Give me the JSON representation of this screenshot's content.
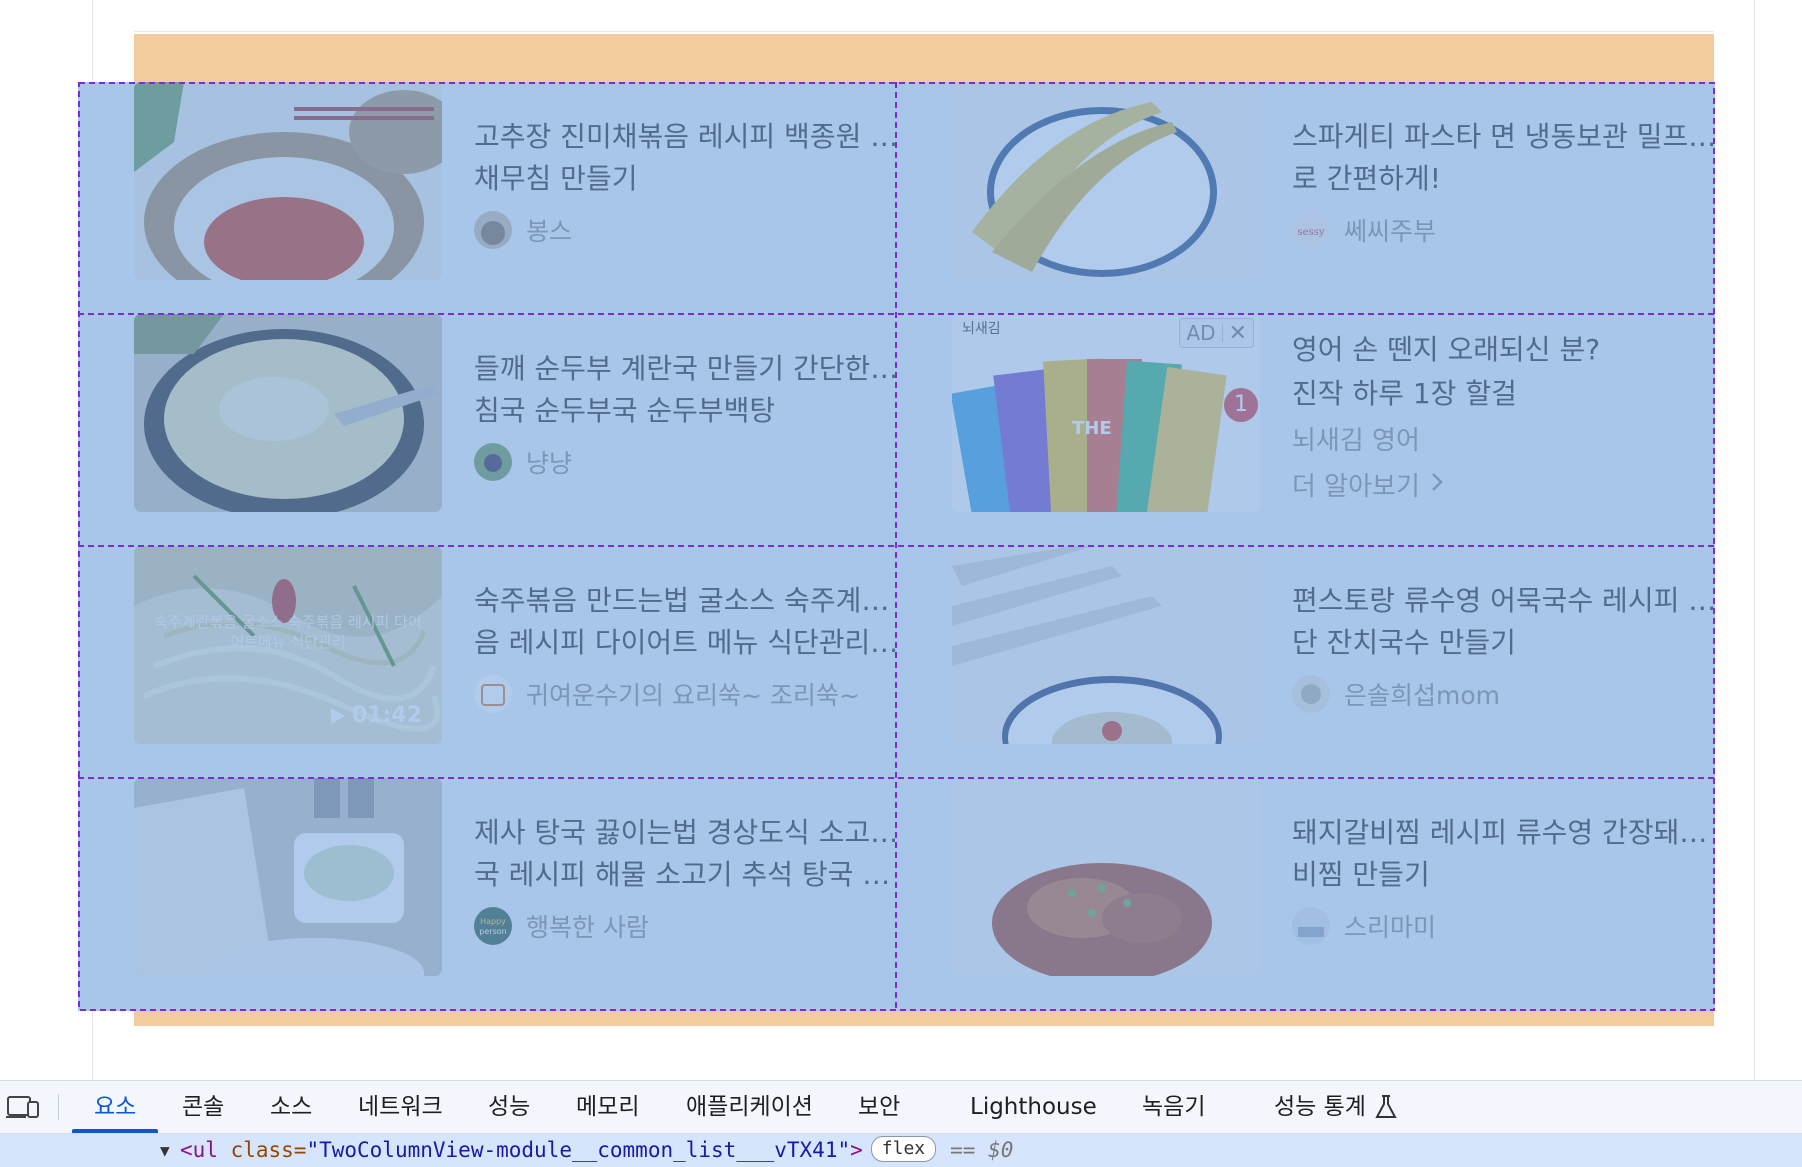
{
  "recipes": [
    {
      "title_line1": "고추장 진미채볶음 레시피 백종원 진미",
      "title_line2": "채무침 만들기",
      "author": "봉스"
    },
    {
      "title_line1": "스파게티 파스타 면 냉동보관 밀프랩으",
      "title_line2": "로 간편하게!",
      "author": "쎄씨주부"
    },
    {
      "title_line1": "들깨 순두부 계란국 만들기 간단한 아",
      "title_line2": "침국 순두부국 순두부백탕",
      "author": "냥냥"
    },
    {
      "title_line1": "숙주볶음 만드는법 굴소스 숙주계란볶",
      "title_line2": "음 레시피 다이어트 메뉴 식단관리 ...",
      "author": "귀여운수기의 요리쑥~ 조리쑥~",
      "duration": "01:42",
      "overlay_caption": "숙주계란볶음 굴소스 숙주볶음 레시피 다이어트메뉴 식단관리"
    },
    {
      "title_line1": "편스토랑 류수영 어묵국수 레시피 초간",
      "title_line2": "단 잔치국수 만들기",
      "author": "은솔희섭mom"
    },
    {
      "title_line1": "제사 탕국 끓이는법 경상도식 소고기무",
      "title_line2": "국 레시피 해물 소고기 추석 탕국 국...",
      "author": "행복한 사람"
    },
    {
      "title_line1": "돼지갈비찜 레시피 류수영 간장돼지갈",
      "title_line2": "비찜 만들기",
      "author": "스리마미"
    }
  ],
  "ad": {
    "brand": "뇌새김",
    "badge": "AD",
    "close": "✕",
    "line1": "영어 손 뗀지 오래되신 분?",
    "line2": "진작 하루 1장 할걸",
    "sponsor": "뇌새김 영어",
    "cta": "더 알아보기",
    "notification_count": "1"
  },
  "devtools": {
    "tabs": [
      "요소",
      "콘솔",
      "소스",
      "네트워크",
      "성능",
      "메모리",
      "애플리케이션",
      "보안",
      "Lighthouse",
      "녹음기",
      "성능 통계"
    ],
    "active_tab": "요소",
    "selected_node": {
      "tag_open": "<ul",
      "attr_name": " class=",
      "attr_value": "\"TwoColumnView-module__common_list___vTX41\"",
      "tag_close": ">",
      "badge": "flex",
      "equals": "==",
      "ref": "$0"
    }
  },
  "colors": {
    "highlight": "#6fa0db",
    "margin": "#f3cc9e",
    "grid_line": "#7b2ddb",
    "active_tab": "#0b57d0",
    "ad_badge_red": "#d93a46"
  }
}
